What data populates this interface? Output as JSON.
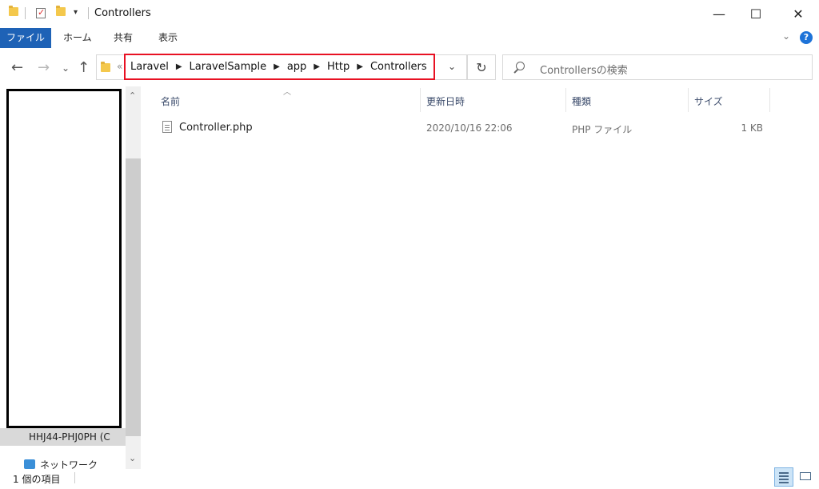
{
  "window": {
    "title": "Controllers",
    "minimize_glyph": "—",
    "maximize_glyph": "☐",
    "close_glyph": "✕"
  },
  "ribbon": {
    "tabs": [
      "ファイル",
      "ホーム",
      "共有",
      "表示"
    ],
    "file_tab_color": "#1e62b6"
  },
  "navigation": {
    "back_glyph": "←",
    "forward_glyph": "→",
    "recent_glyph": "⌄",
    "up_glyph": "↑",
    "overflow_glyph": "«"
  },
  "address_bar": {
    "breadcrumbs": [
      "Laravel",
      "LaravelSample",
      "app",
      "Http",
      "Controllers"
    ],
    "separator_glyph": "›",
    "highlight_color": "#e81123",
    "refresh_glyph": "↻"
  },
  "search": {
    "placeholder": "Controllersの検索"
  },
  "nav_pane": {
    "partial_item_label": "HHJ44-PHJ0PH (C",
    "network_label": "ネットワーク"
  },
  "file_list": {
    "columns": [
      "名前",
      "更新日時",
      "種類",
      "サイズ"
    ],
    "rows": [
      {
        "name": "Controller.php",
        "modified": "2020/10/16 22:06",
        "type": "PHP ファイル",
        "size": "1 KB"
      }
    ]
  },
  "status_bar": {
    "item_count": "1 個の項目"
  },
  "icons": {
    "title_folder": "folder-icon",
    "quick_properties": "properties-check-icon",
    "quick_new_folder": "new-folder-icon",
    "quick_access_dropdown": "chevron-down-icon",
    "file": "document-icon",
    "network": "network-icon",
    "search": "search-icon",
    "help": "help-icon",
    "details_view": "details-view-icon",
    "large_icons_view": "large-icons-view-icon"
  }
}
